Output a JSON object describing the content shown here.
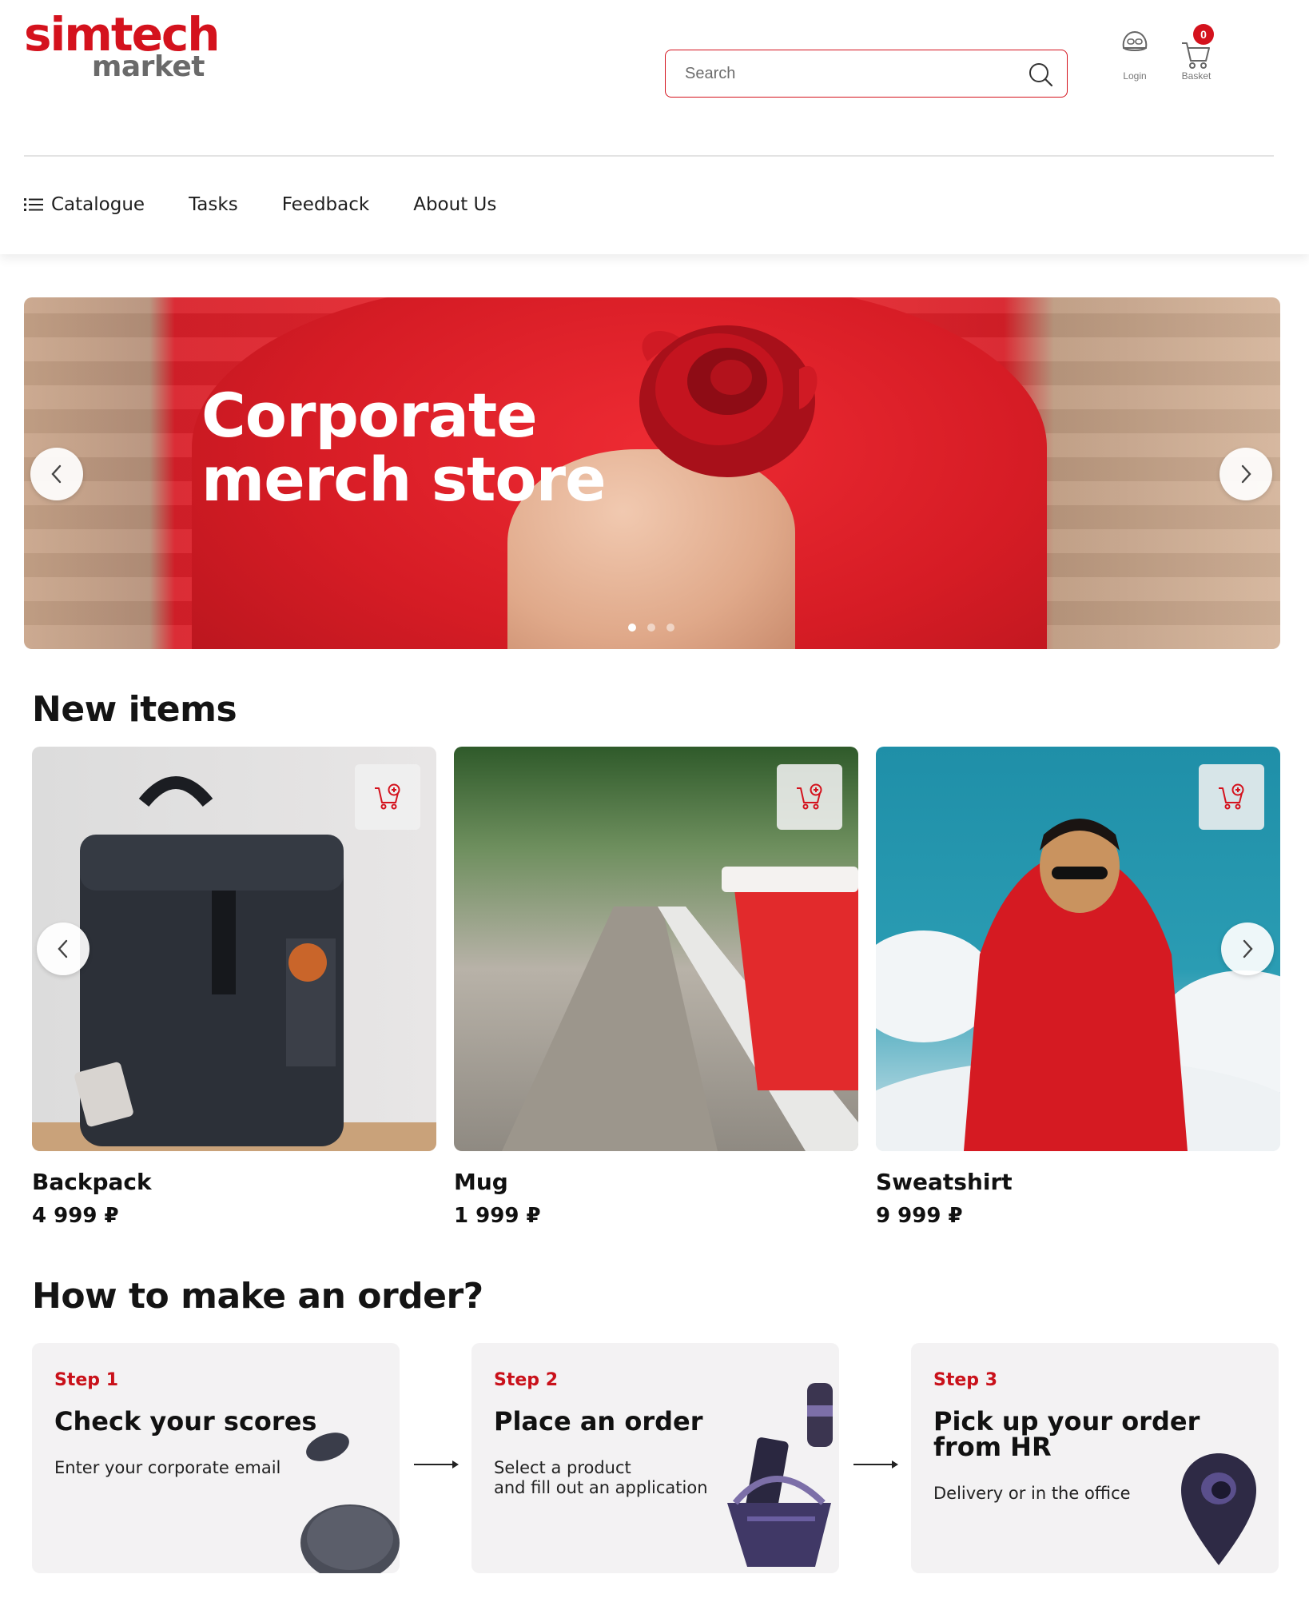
{
  "brand": {
    "line1": "simtech",
    "line2": "market",
    "accent_color": "#d4121d"
  },
  "search": {
    "placeholder": "Search",
    "icon": "search-icon"
  },
  "header_actions": {
    "login_label": "Login",
    "basket_label": "Basket",
    "basket_count": "0"
  },
  "nav": {
    "catalogue": "Catalogue",
    "tasks": "Tasks",
    "feedback": "Feedback",
    "about": "About Us"
  },
  "hero": {
    "title": "Corporate merch store",
    "slide_count": 3,
    "active_slide": 1
  },
  "new_items": {
    "title": "New items",
    "products": [
      {
        "name": "Backpack",
        "price": "4 999 ₽"
      },
      {
        "name": "Mug",
        "price": "1 999 ₽"
      },
      {
        "name": "Sweatshirt",
        "price": "9 999 ₽"
      }
    ]
  },
  "how_to": {
    "title": "How to make an order?",
    "steps": [
      {
        "step": "Step 1",
        "title": "Check your scores",
        "desc": "Enter your corporate email"
      },
      {
        "step": "Step 2",
        "title": "Place an order",
        "desc": "Select a product\nand fill out an application"
      },
      {
        "step": "Step 3",
        "title": "Pick up your order from HR",
        "desc": "Delivery or in the office"
      }
    ]
  }
}
